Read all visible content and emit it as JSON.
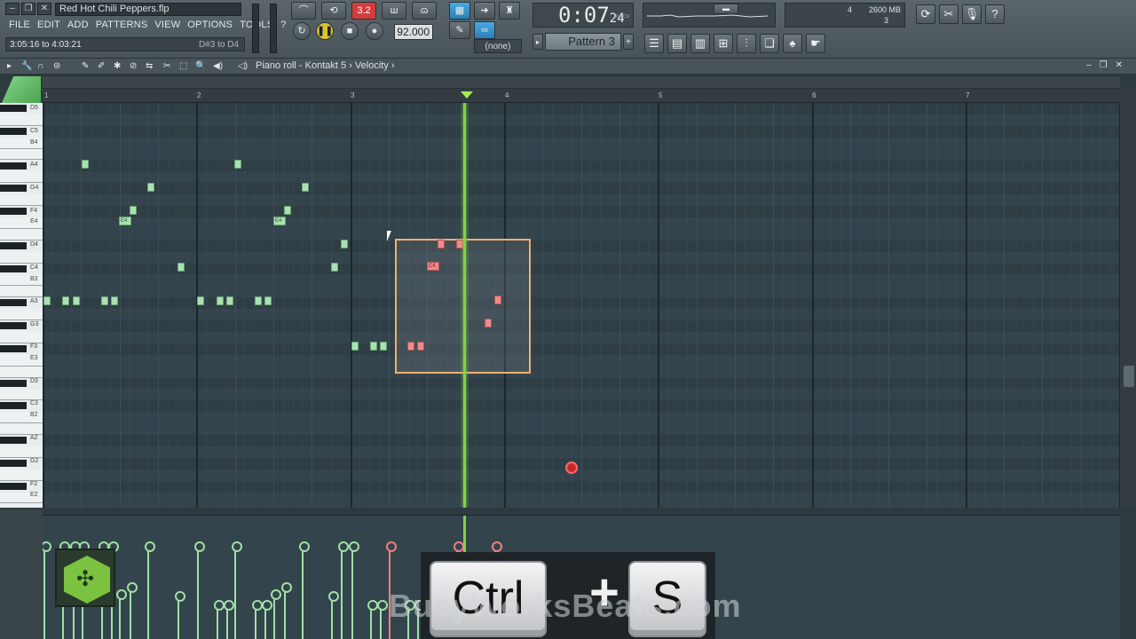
{
  "window": {
    "project_title": "Red Hot Chili Peppers.flp",
    "hint_left": "3:05:16 to 4:03:21",
    "hint_right": "D#3 to D4"
  },
  "menu": [
    "FILE",
    "EDIT",
    "ADD",
    "PATTERNS",
    "VIEW",
    "OPTIONS",
    "TOOLS",
    "?"
  ],
  "transport": {
    "time_main": "0:07",
    "time_ms": "24",
    "time_label": "M:S:CS",
    "tempo": "92.000",
    "pattern": "Pattern 3",
    "channel_none": "(none)",
    "snap_display": "3.2"
  },
  "monitor": {
    "cpu_value": "4",
    "ram": "2600 MB",
    "polyphony": "3"
  },
  "piano_roll": {
    "breadcrumb": [
      "Piano roll",
      "Kontakt 5",
      "Velocity"
    ],
    "bar_numbers": [
      "1",
      "2",
      "3",
      "4",
      "5",
      "6",
      "7"
    ],
    "key_labels": [
      "D5",
      "C5",
      "B4",
      "A4",
      "G4",
      "F4",
      "E4",
      "D4",
      "C4",
      "B3",
      "A3",
      "G3",
      "F3",
      "E3",
      "D3",
      "C3",
      "B2",
      "A2",
      "G2",
      "F2",
      "E2"
    ],
    "note_labels": {
      "e4a": "E4",
      "e4b": "E4",
      "c4": "C4"
    }
  },
  "overlay": {
    "key1": "Ctrl",
    "plus": "+",
    "key2": "S",
    "watermark": "BusyWorksBeats.com"
  },
  "colors": {
    "note": "#a8e2b0",
    "selected_note": "#f08a8a",
    "playhead": "#7fd43e",
    "selection": "#f2b070"
  }
}
